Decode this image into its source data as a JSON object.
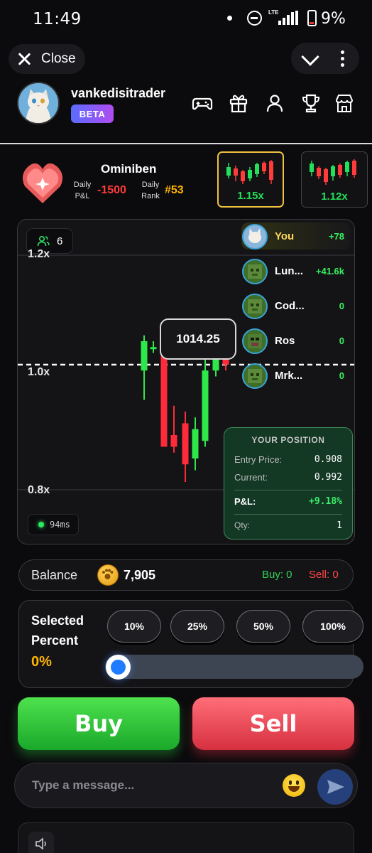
{
  "status_bar": {
    "time": "11:49",
    "network": "LTE",
    "battery": "9%"
  },
  "nav": {
    "close_label": "Close"
  },
  "profile": {
    "username": "vankedisitrader",
    "badge": "BETA"
  },
  "stats": {
    "player": "Ominiben",
    "pnl_label_1": "Daily",
    "pnl_label_2": "P&L",
    "pnl_value": "-1500",
    "rank_label_1": "Daily",
    "rank_label_2": "Rank",
    "rank_value": "#53",
    "rooms": [
      {
        "multiplier": "1.15x",
        "selected": true
      },
      {
        "multiplier": "1.12x",
        "selected": false
      }
    ]
  },
  "chart": {
    "players_count": "6",
    "y_labels": {
      "top": "1.2x",
      "mid": "1.0x",
      "low": "0.8x"
    },
    "current_price": "1014.25",
    "latency": "94ms",
    "leaderboard": [
      {
        "name": "You",
        "score": "+78"
      },
      {
        "name": "Lun...",
        "score": "+41.6k"
      },
      {
        "name": "Cod...",
        "score": "0"
      },
      {
        "name": "Ros",
        "score": "0"
      },
      {
        "name": "Mrk...",
        "score": "0"
      }
    ],
    "position": {
      "title": "YOUR POSITION",
      "entry_label": "Entry Price:",
      "entry_value": "0.908",
      "current_label": "Current:",
      "current_value": "0.992",
      "pnl_label": "P&L:",
      "pnl_value": "+9.18%",
      "qty_label": "Qty:",
      "qty_value": "1"
    }
  },
  "chart_data": {
    "type": "candlestick",
    "y_ticks": [
      "0.8x",
      "1.0x",
      "1.2x"
    ],
    "reference_line": "1.0x",
    "candles": [
      {
        "open": 0.99,
        "close": 1.04,
        "high": 1.05,
        "low": 0.94,
        "dir": "up"
      },
      {
        "open": 1.03,
        "close": 1.03,
        "high": 1.04,
        "low": 1.02,
        "dir": "flat"
      },
      {
        "open": 1.03,
        "close": 0.86,
        "high": 1.05,
        "low": 0.86,
        "dir": "down"
      },
      {
        "open": 0.88,
        "close": 0.86,
        "high": 0.93,
        "low": 0.85,
        "dir": "down"
      },
      {
        "open": 0.9,
        "close": 0.83,
        "high": 0.92,
        "low": 0.8,
        "dir": "down"
      },
      {
        "open": 0.84,
        "close": 0.89,
        "high": 0.91,
        "low": 0.82,
        "dir": "up"
      },
      {
        "open": 0.87,
        "close": 0.99,
        "high": 1.01,
        "low": 0.86,
        "dir": "up"
      },
      {
        "open": 0.99,
        "close": 1.01,
        "high": 1.02,
        "low": 0.98,
        "dir": "up"
      },
      {
        "open": 1.01,
        "close": 1.0,
        "high": 1.01,
        "low": 0.99,
        "dir": "down"
      }
    ]
  },
  "balance": {
    "label": "Balance",
    "value": "7,905",
    "buy": "Buy: 0",
    "sell": "Sell: 0"
  },
  "selector": {
    "title_1": "Selected",
    "title_2": "Percent",
    "value": "0%",
    "value_fraction": 0,
    "options": [
      "10%",
      "25%",
      "50%",
      "100%"
    ]
  },
  "actions": {
    "buy": "Buy",
    "sell": "Sell"
  },
  "chat": {
    "placeholder": "Type a message..."
  },
  "colors": {
    "green": "#22e05a",
    "red": "#ff3b3b",
    "gold": "#ffb400",
    "accent_blue": "#1f7bff"
  }
}
